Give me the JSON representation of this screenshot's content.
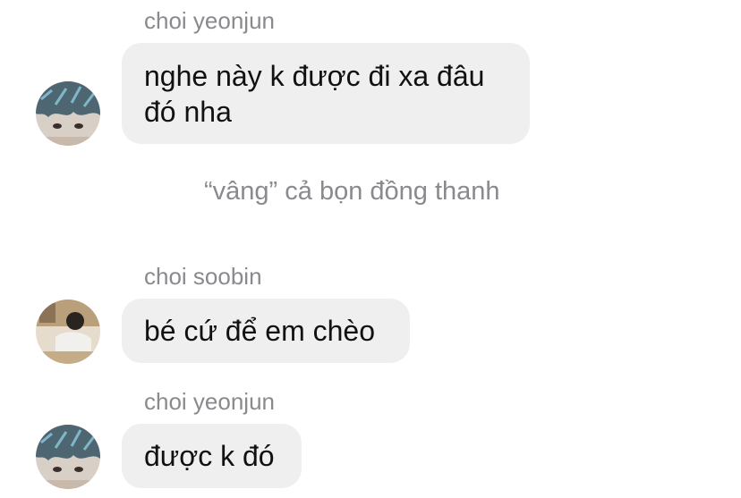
{
  "messages": [
    {
      "sender": "choi yeonjun",
      "text": "nghe này k được đi xa đâu đó nha",
      "avatar": "yeonjun-avatar"
    },
    {
      "system": "“vâng” cả bọn đồng thanh"
    },
    {
      "sender": "choi soobin",
      "text": "bé cứ để em chèo",
      "avatar": "soobin-avatar"
    },
    {
      "sender": "choi yeonjun",
      "text": "được k đó",
      "avatar": "yeonjun-avatar"
    }
  ],
  "colors": {
    "bubble": "#efefef",
    "secondary_text": "#8a8a8e",
    "primary_text": "#111111"
  }
}
